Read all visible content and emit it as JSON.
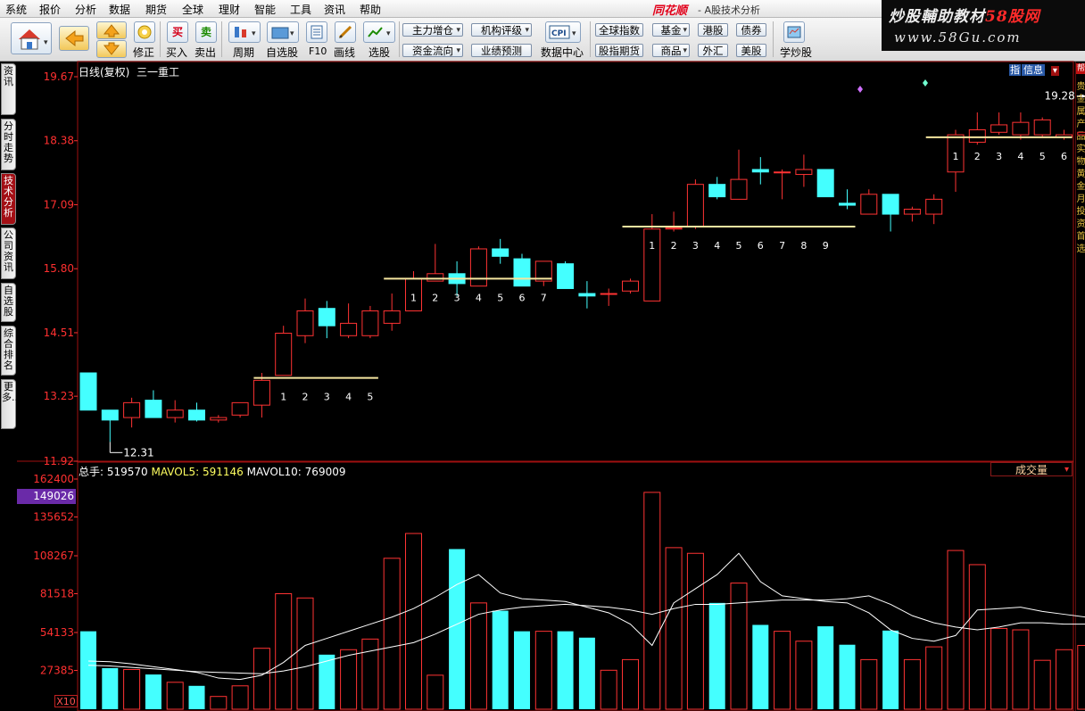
{
  "menu": [
    "系统",
    "报价",
    "分析",
    "数据",
    "期货",
    "全球",
    "理财",
    "智能",
    "工具",
    "资讯",
    "帮助"
  ],
  "window": {
    "brand": "同花顺",
    "title": "- A股技术分析"
  },
  "watermark": {
    "line1a": "炒股輔助教材",
    "line1b": "58股网",
    "line2": "www.58Gu.com"
  },
  "toolbar": {
    "labels": {
      "buy": "买入",
      "sell": "卖出",
      "fix": "修正",
      "period": "周期",
      "watchlist": "自选股",
      "f10": "F10",
      "draw": "画线",
      "select": "选股",
      "datacenter": "数据中心",
      "learn": "学炒股"
    },
    "icon_chars": {
      "buy": "买",
      "sell": "卖"
    },
    "pills": {
      "main_holdings": "主力增仓",
      "rating": "机构评级",
      "fund_flow": "资金流向",
      "earnings": "业绩预测",
      "global_index": "全球指数",
      "fund": "基金",
      "hk": "港股",
      "bond": "债券",
      "index_futures": "股指期货",
      "commodities": "商品",
      "forex": "外汇",
      "us": "美股"
    },
    "cpi": "CPI"
  },
  "left_tabs": [
    "资讯",
    "分时走势",
    "技术分析",
    "公司资讯",
    "自选股",
    "综合排名",
    "更多..."
  ],
  "left_tabs_active": 2,
  "right_strip": {
    "text": "贵金属产品实物黄金月投资首选",
    "label": "帮"
  },
  "price_panel": {
    "title": "日线(复权)",
    "stock": "三一重工",
    "info_a": "指",
    "info_b": "信息",
    "yaxis": [
      "19.67",
      "18.38",
      "17.09",
      "15.80",
      "14.51",
      "13.23",
      "11.92"
    ],
    "low_label": "12.31",
    "high_label": "19.28"
  },
  "volume_panel": {
    "legend_total_label": "总手:",
    "legend_total": "519570",
    "legend_ma5_label": "MAVOL5:",
    "legend_ma5": "591146",
    "legend_ma10_label": "MAVOL10:",
    "legend_ma10": "769009",
    "dropdown": "成交量",
    "yaxis": [
      "162400",
      "135652",
      "108267",
      "81518",
      "54133",
      "27385"
    ],
    "highlight": "149026",
    "unit": "X10"
  },
  "colors": {
    "up": "#ff3333",
    "down": "#44ffff",
    "ma5": "#ffffff",
    "ma10": "#ffffff",
    "platform": "#f5e6a0",
    "axis_text": "#ff3030",
    "grid_frame": "#a01010"
  },
  "chart_data": {
    "type": "candlestick",
    "candles": [
      {
        "o": 13.7,
        "h": 13.7,
        "l": 12.95,
        "c": 12.95
      },
      {
        "o": 12.95,
        "h": 12.95,
        "l": 12.31,
        "c": 12.75
      },
      {
        "o": 12.8,
        "h": 13.2,
        "l": 12.6,
        "c": 13.1
      },
      {
        "o": 13.15,
        "h": 13.35,
        "l": 12.8,
        "c": 12.8
      },
      {
        "o": 12.8,
        "h": 13.15,
        "l": 12.7,
        "c": 12.95
      },
      {
        "o": 12.95,
        "h": 13.1,
        "l": 12.72,
        "c": 12.75
      },
      {
        "o": 12.75,
        "h": 12.85,
        "l": 12.7,
        "c": 12.8
      },
      {
        "o": 12.85,
        "h": 13.1,
        "l": 12.8,
        "c": 13.1
      },
      {
        "o": 13.05,
        "h": 13.7,
        "l": 12.8,
        "c": 13.55
      },
      {
        "o": 13.65,
        "h": 14.65,
        "l": 13.65,
        "c": 14.5
      },
      {
        "o": 14.45,
        "h": 15.2,
        "l": 14.3,
        "c": 14.95
      },
      {
        "o": 15.0,
        "h": 15.15,
        "l": 14.4,
        "c": 14.65
      },
      {
        "o": 14.45,
        "h": 15.1,
        "l": 14.4,
        "c": 14.7
      },
      {
        "o": 14.45,
        "h": 15.05,
        "l": 14.4,
        "c": 14.95
      },
      {
        "o": 14.7,
        "h": 15.3,
        "l": 14.55,
        "c": 14.95
      },
      {
        "o": 14.95,
        "h": 15.75,
        "l": 14.95,
        "c": 15.6
      },
      {
        "o": 15.55,
        "h": 16.3,
        "l": 15.55,
        "c": 15.7
      },
      {
        "o": 15.7,
        "h": 15.95,
        "l": 15.25,
        "c": 15.5
      },
      {
        "o": 15.45,
        "h": 16.25,
        "l": 15.45,
        "c": 16.2
      },
      {
        "o": 16.2,
        "h": 16.4,
        "l": 15.9,
        "c": 16.05
      },
      {
        "o": 16.0,
        "h": 16.1,
        "l": 15.5,
        "c": 15.45
      },
      {
        "o": 15.55,
        "h": 15.95,
        "l": 15.45,
        "c": 15.95
      },
      {
        "o": 15.9,
        "h": 15.95,
        "l": 15.4,
        "c": 15.4
      },
      {
        "o": 15.3,
        "h": 15.55,
        "l": 15.0,
        "c": 15.25
      },
      {
        "o": 15.3,
        "h": 15.4,
        "l": 15.05,
        "c": 15.3
      },
      {
        "o": 15.35,
        "h": 15.6,
        "l": 15.3,
        "c": 15.55
      },
      {
        "o": 15.15,
        "h": 16.9,
        "l": 15.15,
        "c": 16.6
      },
      {
        "o": 16.6,
        "h": 16.95,
        "l": 16.55,
        "c": 16.62
      },
      {
        "o": 16.65,
        "h": 17.6,
        "l": 16.6,
        "c": 17.5
      },
      {
        "o": 17.5,
        "h": 17.65,
        "l": 17.2,
        "c": 17.25
      },
      {
        "o": 17.2,
        "h": 18.2,
        "l": 17.2,
        "c": 17.6
      },
      {
        "o": 17.8,
        "h": 18.05,
        "l": 17.5,
        "c": 17.75
      },
      {
        "o": 17.75,
        "h": 17.8,
        "l": 17.2,
        "c": 17.75
      },
      {
        "o": 17.7,
        "h": 18.1,
        "l": 17.45,
        "c": 17.8
      },
      {
        "o": 17.8,
        "h": 17.8,
        "l": 17.25,
        "c": 17.25
      },
      {
        "o": 17.12,
        "h": 17.4,
        "l": 17.0,
        "c": 17.08
      },
      {
        "o": 16.9,
        "h": 17.4,
        "l": 16.9,
        "c": 17.3
      },
      {
        "o": 17.3,
        "h": 17.3,
        "l": 16.55,
        "c": 16.9
      },
      {
        "o": 16.9,
        "h": 17.05,
        "l": 16.75,
        "c": 17.0
      },
      {
        "o": 16.9,
        "h": 17.3,
        "l": 16.7,
        "c": 17.2
      },
      {
        "o": 17.75,
        "h": 18.6,
        "l": 17.35,
        "c": 18.5
      },
      {
        "o": 18.35,
        "h": 18.95,
        "l": 18.3,
        "c": 18.6
      },
      {
        "o": 18.55,
        "h": 18.95,
        "l": 18.5,
        "c": 18.7
      },
      {
        "o": 18.5,
        "h": 18.95,
        "l": 18.4,
        "c": 18.75
      },
      {
        "o": 18.5,
        "h": 18.85,
        "l": 18.45,
        "c": 18.8
      },
      {
        "o": 18.45,
        "h": 18.6,
        "l": 18.4,
        "c": 18.5
      },
      {
        "o": 18.5,
        "h": 19.28,
        "l": 18.5,
        "c": 18.55
      }
    ],
    "volume": [
      55000,
      29000,
      28000,
      24500,
      19000,
      16500,
      9000,
      16500,
      43000,
      81500,
      78500,
      38500,
      42000,
      49500,
      106500,
      124000,
      24000,
      113000,
      75000,
      69500,
      55000,
      55000,
      55000,
      50500,
      27500,
      35000,
      153000,
      114000,
      110000,
      75000,
      89000,
      59500,
      55000,
      48000,
      58500,
      45500,
      35000,
      55500,
      35000,
      44000,
      112000,
      102000,
      57000,
      56000,
      34500,
      42000,
      45000
    ],
    "mavol5": [
      34000,
      33500,
      32000,
      30000,
      28000,
      26000,
      22000,
      21000,
      24000,
      33000,
      45000,
      50000,
      55000,
      60000,
      65000,
      71000,
      79000,
      88000,
      95000,
      82000,
      78000,
      77000,
      76000,
      72000,
      68000,
      60000,
      45000,
      75000,
      85000,
      95000,
      110000,
      90000,
      80000,
      78000,
      76000,
      75000,
      68000,
      56000,
      50000,
      48000,
      52000,
      70000,
      71000,
      72000,
      69000,
      67000,
      65000
    ],
    "mavol10": [
      31000,
      30500,
      29500,
      28500,
      27500,
      26500,
      26000,
      25500,
      25000,
      27000,
      30000,
      34000,
      38000,
      41000,
      44000,
      47000,
      53000,
      60000,
      67000,
      70000,
      72000,
      73000,
      74000,
      73000,
      72000,
      70000,
      67000,
      71000,
      74000,
      74000,
      75000,
      76000,
      77000,
      77000,
      77000,
      78000,
      80000,
      74000,
      66000,
      61000,
      58000,
      56000,
      58000,
      61000,
      61000,
      60000,
      60000
    ],
    "platforms": [
      {
        "from": 8,
        "to": 13,
        "price": 13.6,
        "labels": [
          "1",
          "2",
          "3",
          "4",
          "5"
        ]
      },
      {
        "from": 14,
        "to": 21,
        "price": 15.6,
        "labels": [
          "1",
          "2",
          "3",
          "4",
          "5",
          "6",
          "7"
        ]
      },
      {
        "from": 25,
        "to": 35,
        "price": 16.65,
        "labels": [
          "1",
          "2",
          "3",
          "4",
          "5",
          "6",
          "7",
          "8",
          "9"
        ]
      },
      {
        "from": 39,
        "to": 45,
        "price": 18.45,
        "labels": [
          "1",
          "2",
          "3",
          "4",
          "5",
          "6"
        ]
      }
    ],
    "price_range": [
      11.92,
      19.67
    ],
    "volume_max": 162400
  }
}
